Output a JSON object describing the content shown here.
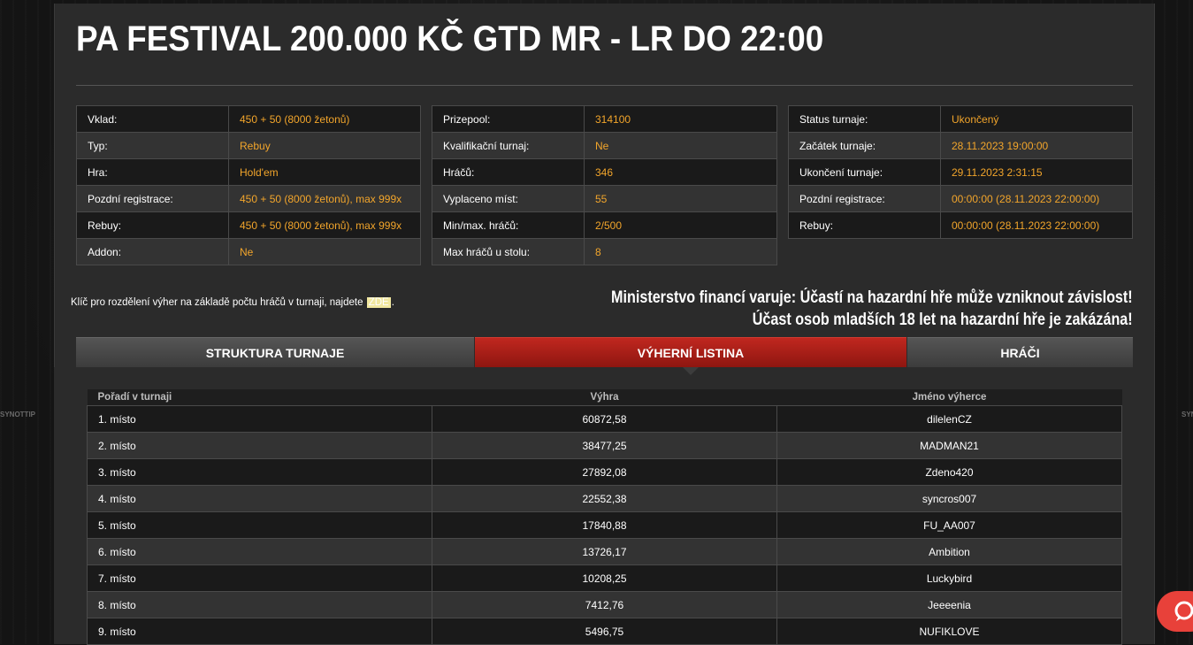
{
  "title": "PA FESTIVAL 200.000 KČ GTD MR - LR DO 22:00",
  "info_col1": [
    {
      "key": "Vklad:",
      "value": "450 + 50 (8000 žetonů)"
    },
    {
      "key": "Typ:",
      "value": "Rebuy"
    },
    {
      "key": "Hra:",
      "value": "Hold'em"
    },
    {
      "key": "Pozdní registrace:",
      "value": "450 + 50 (8000 žetonů), max 999x"
    },
    {
      "key": "Rebuy:",
      "value": "450 + 50 (8000 žetonů), max 999x"
    },
    {
      "key": "Addon:",
      "value": "Ne"
    }
  ],
  "info_col2": [
    {
      "key": "Prizepool:",
      "value": "314100"
    },
    {
      "key": "Kvalifikační turnaj:",
      "value": "Ne"
    },
    {
      "key": "Hráčů:",
      "value": "346"
    },
    {
      "key": "Vyplaceno míst:",
      "value": "55"
    },
    {
      "key": "Min/max. hráčů:",
      "value": "2/500"
    },
    {
      "key": "Max hráčů u stolu:",
      "value": "8"
    }
  ],
  "info_col3": [
    {
      "key": "Status turnaje:",
      "value": "Ukončený"
    },
    {
      "key": "Začátek turnaje:",
      "value": "28.11.2023 19:00:00"
    },
    {
      "key": "Ukončení turnaje:",
      "value": "29.11.2023 2:31:15"
    },
    {
      "key": "Pozdní registrace:",
      "value": "00:00:00 (28.11.2023 22:00:00)"
    },
    {
      "key": "Rebuy:",
      "value": "00:00:00 (28.11.2023 22:00:00)"
    }
  ],
  "note": {
    "prefix": "Klíč pro rozdělení výher na základě počtu hráčů v turnaji, najdete",
    "link": "ZDE",
    "suffix": "."
  },
  "warning": {
    "line1": "Ministerstvo financí varuje: Účastí na hazardní hře může vzniknout závislost!",
    "line2": "Účast osob mladších 18 let na hazardní hře je zakázána!"
  },
  "tabs": [
    {
      "label": "STRUKTURA TURNAJE",
      "active": false
    },
    {
      "label": "VÝHERNÍ LISTINA",
      "active": true
    },
    {
      "label": "HRÁČI",
      "active": false
    }
  ],
  "winners": {
    "headers": [
      "Pořadí v turnaji",
      "Výhra",
      "Jméno výherce"
    ],
    "rows": [
      [
        "1. místo",
        "60872,58",
        "dilelenCZ"
      ],
      [
        "2. místo",
        "38477,25",
        "MADMAN21"
      ],
      [
        "3. místo",
        "27892,08",
        "Zdeno420"
      ],
      [
        "4. místo",
        "22552,38",
        "syncros007"
      ],
      [
        "5. místo",
        "17840,88",
        "FU_AA007"
      ],
      [
        "6. místo",
        "13726,17",
        "Ambition"
      ],
      [
        "7. místo",
        "10208,25",
        "Luckybird"
      ],
      [
        "8. místo",
        "7412,76",
        "Jeeeenia"
      ],
      [
        "9. místo",
        "5496,75",
        "NUFIKLOVE"
      ]
    ]
  },
  "side_logo": "SYNOTTIP",
  "colors": {
    "accent": "#f2a52b",
    "active_tab": "#b01e17",
    "chat": "#e8413a"
  },
  "icons": {
    "chat": "chat-bubble-icon"
  }
}
